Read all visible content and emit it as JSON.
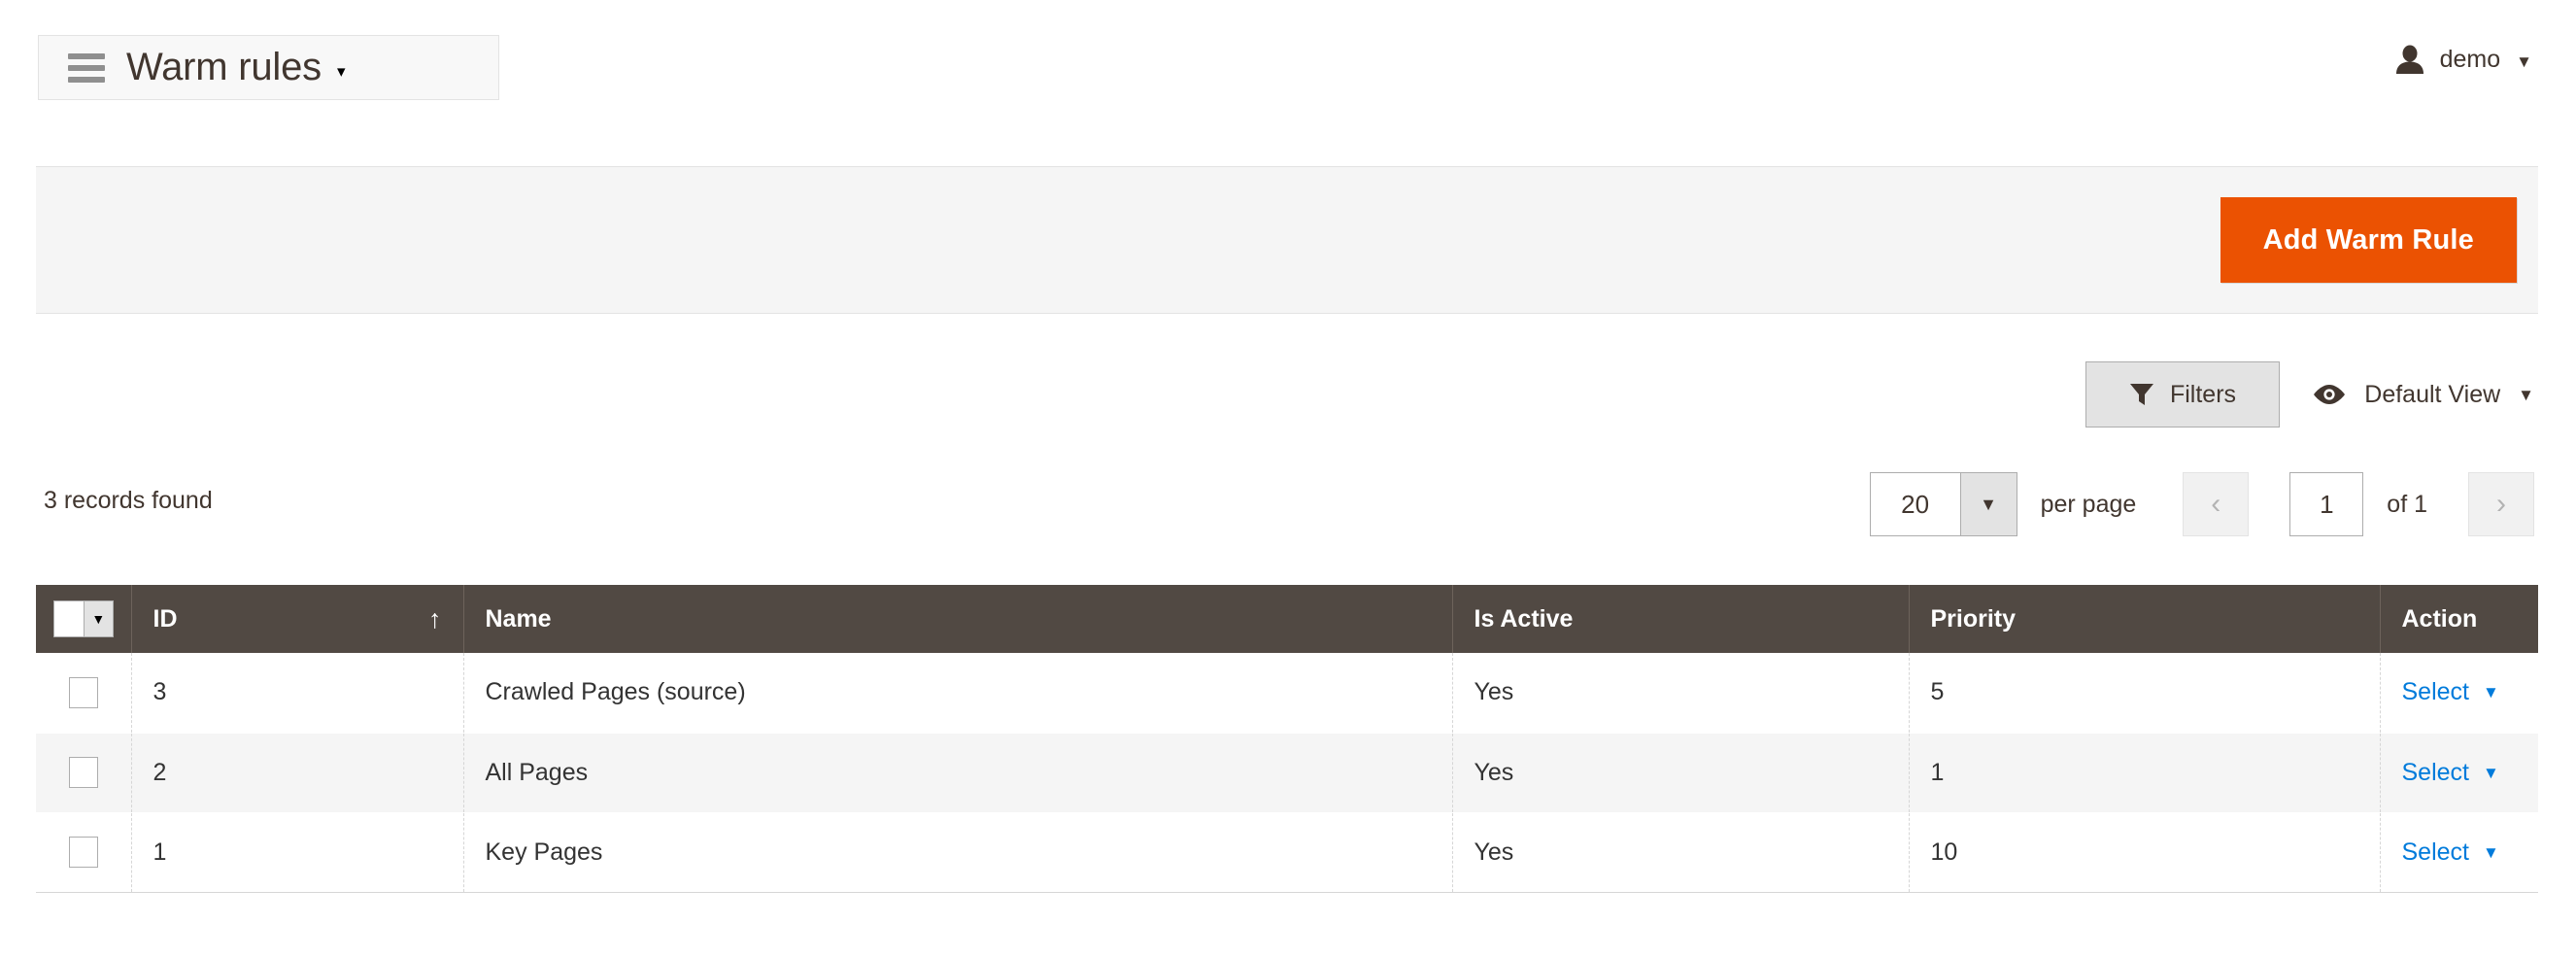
{
  "header": {
    "menu_icon": "hamburger-icon",
    "title": "Warm rules",
    "title_caret": "▾",
    "user_icon": "user-icon",
    "user_name": "demo",
    "user_caret": "▼"
  },
  "page_actions": {
    "add_button_label": "Add Warm Rule",
    "accent_color": "#eb5202"
  },
  "toolbar": {
    "filters_label": "Filters",
    "filters_icon": "funnel-icon",
    "view_icon": "eye-icon",
    "view_label": "Default View",
    "view_caret": "▼"
  },
  "grid_header": {
    "records_found": "3 records found",
    "per_page_value": "20",
    "per_page_caret": "▼",
    "per_page_label": "per page",
    "prev_icon": "‹",
    "next_icon": "›",
    "page_value": "1",
    "of_label": "of 1"
  },
  "grid": {
    "mass_select_caret": "▼",
    "columns": [
      {
        "label": "ID",
        "sort": "↑"
      },
      {
        "label": "Name",
        "sort": ""
      },
      {
        "label": "Is Active",
        "sort": ""
      },
      {
        "label": "Priority",
        "sort": ""
      },
      {
        "label": "Action",
        "sort": ""
      }
    ],
    "rows": [
      {
        "id": "3",
        "name": "Crawled Pages (source)",
        "is_active": "Yes",
        "priority": "5",
        "action_label": "Select",
        "action_caret": "▼"
      },
      {
        "id": "2",
        "name": "All Pages",
        "is_active": "Yes",
        "priority": "1",
        "action_label": "Select",
        "action_caret": "▼"
      },
      {
        "id": "1",
        "name": "Key Pages",
        "is_active": "Yes",
        "priority": "10",
        "action_label": "Select",
        "action_caret": "▼"
      }
    ]
  },
  "colors": {
    "grid_header_bg": "#514943",
    "link_blue": "#007bdb",
    "orange": "#eb5202"
  }
}
